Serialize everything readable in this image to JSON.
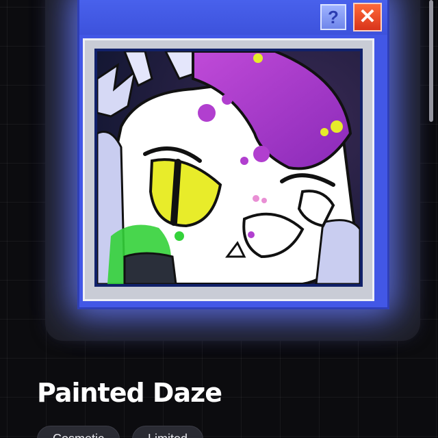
{
  "item": {
    "title": "Painted Daze",
    "tags": [
      "Cosmetic",
      "Limited"
    ]
  },
  "window": {
    "help_glyph": "?",
    "help_icon": "question-icon",
    "close_glyph": "✕",
    "close_icon": "close-icon"
  },
  "colors": {
    "background": "#0c0c0f",
    "card": "#1e1f27",
    "window_blue": "#4257e6",
    "close_red": "#e23f1f",
    "paint_purple": "#a536c8",
    "eye_yellow": "#e8ec2a",
    "slime_green": "#34d23a"
  }
}
